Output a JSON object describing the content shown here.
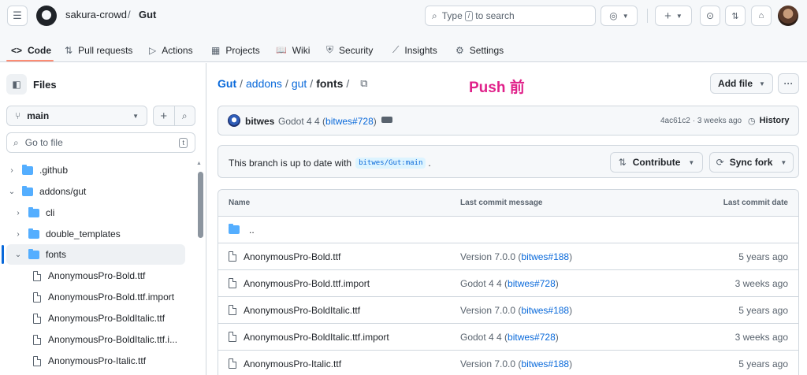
{
  "header": {
    "owner": "sakura-crowd",
    "separator": "/",
    "repo": "Gut",
    "search_prefix": "Type",
    "search_key": "/",
    "search_suffix": "to search",
    "plus_label": "+"
  },
  "tabs": [
    {
      "label": "Code",
      "icon": "<>"
    },
    {
      "label": "Pull requests",
      "icon": "⇅"
    },
    {
      "label": "Actions",
      "icon": "▷"
    },
    {
      "label": "Projects",
      "icon": "▦"
    },
    {
      "label": "Wiki",
      "icon": "📖"
    },
    {
      "label": "Security",
      "icon": "⛨"
    },
    {
      "label": "Insights",
      "icon": "⟋"
    },
    {
      "label": "Settings",
      "icon": "⚙"
    }
  ],
  "sidebar": {
    "title": "Files",
    "branch": "main",
    "goto_placeholder": "Go to file",
    "goto_key": "t",
    "tree": [
      {
        "label": ".github",
        "type": "folder",
        "expanded": false
      },
      {
        "label": "addons/gut",
        "type": "folder",
        "expanded": true
      },
      {
        "label": "cli",
        "type": "folder",
        "expanded": false
      },
      {
        "label": "double_templates",
        "type": "folder",
        "expanded": false
      },
      {
        "label": "fonts",
        "type": "folder",
        "expanded": true
      },
      {
        "label": "AnonymousPro-Bold.ttf",
        "type": "file"
      },
      {
        "label": "AnonymousPro-Bold.ttf.import",
        "type": "file"
      },
      {
        "label": "AnonymousPro-BoldItalic.ttf",
        "type": "file"
      },
      {
        "label": "AnonymousPro-BoldItalic.ttf.i...",
        "type": "file"
      },
      {
        "label": "AnonymousPro-Italic.ttf",
        "type": "file"
      }
    ]
  },
  "main": {
    "path": {
      "p1": "Gut",
      "p2": "addons",
      "p3": "gut",
      "current": "fonts",
      "sep": "/"
    },
    "annotation": "Push 前",
    "add_file": "Add file",
    "more": "···",
    "commit": {
      "author": "bitwes",
      "msg_prefix": "Godot 4 4 (",
      "msg_link": "bitwes#728",
      "msg_suffix": ")",
      "sha": "4ac61c2",
      "age": "· 3 weeks ago",
      "history": "History"
    },
    "branch_status_prefix": "This branch is up to date with",
    "branch_status_ref": "bitwes/Gut:main",
    "branch_status_suffix": ".",
    "contribute": "Contribute",
    "sync_fork": "Sync fork",
    "table_headers": {
      "name": "Name",
      "message": "Last commit message",
      "date": "Last commit date"
    },
    "parent_dir": "..",
    "rows": [
      {
        "name": "AnonymousPro-Bold.ttf",
        "msg_prefix": "Version 7.0.0 (",
        "msg_link": "bitwes#188",
        "msg_suffix": ")",
        "date": "5 years ago"
      },
      {
        "name": "AnonymousPro-Bold.ttf.import",
        "msg_prefix": "Godot 4 4 (",
        "msg_link": "bitwes#728",
        "msg_suffix": ")",
        "date": "3 weeks ago"
      },
      {
        "name": "AnonymousPro-BoldItalic.ttf",
        "msg_prefix": "Version 7.0.0 (",
        "msg_link": "bitwes#188",
        "msg_suffix": ")",
        "date": "5 years ago"
      },
      {
        "name": "AnonymousPro-BoldItalic.ttf.import",
        "msg_prefix": "Godot 4 4 (",
        "msg_link": "bitwes#728",
        "msg_suffix": ")",
        "date": "3 weeks ago"
      },
      {
        "name": "AnonymousPro-Italic.ttf",
        "msg_prefix": "Version 7.0.0 (",
        "msg_link": "bitwes#188",
        "msg_suffix": ")",
        "date": "5 years ago"
      }
    ]
  },
  "colors": {
    "accent": "#0969da",
    "annotation": "#e0218a",
    "tab_underline": "#fd8c73"
  }
}
